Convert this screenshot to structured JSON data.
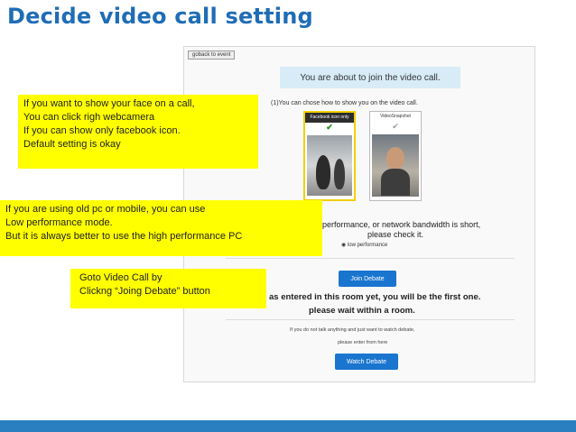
{
  "slide": {
    "title": "Decide video call setting"
  },
  "screenshot": {
    "goback_label": "goback to event",
    "banner": "You are about to join the video call.",
    "choose_text": "(1)You can chose how to show you on the video call.",
    "options": [
      {
        "label": "Facebook icon only",
        "check": "✔",
        "selected": true
      },
      {
        "label": "VideoSnapshot",
        "check": "✔",
        "selected": false
      }
    ],
    "performance_text": "performance, or network bandwidth is short,",
    "check_text": "please check it.",
    "low_performance_label": "low performance",
    "join_button": "Join Debate",
    "entered_text": "as entered in this room yet, you will be the first one.",
    "wait_text": "please wait within a room.",
    "note_line1": "If you do not talk anything and just want to watch debate,",
    "note_line2": "please enter from here",
    "watch_button": "Watch Debate"
  },
  "callouts": {
    "webcam": [
      "If you want to show your face on a call,",
      "You can click righ webcamera",
      "If you can show only facebook icon.",
      "Default setting is okay"
    ],
    "performance": [
      "If you are using old pc or mobile, you can use",
      "Low performance mode.",
      "But it is always better to use the high performance PC"
    ],
    "join": [
      "Goto Video Call by",
      "Clickng “Joing Debate” button"
    ]
  },
  "colors": {
    "title": "#1f6db5",
    "callout_bg": "#ffff00",
    "button": "#1a75cf",
    "bottom_band": "#2a7fc0"
  }
}
